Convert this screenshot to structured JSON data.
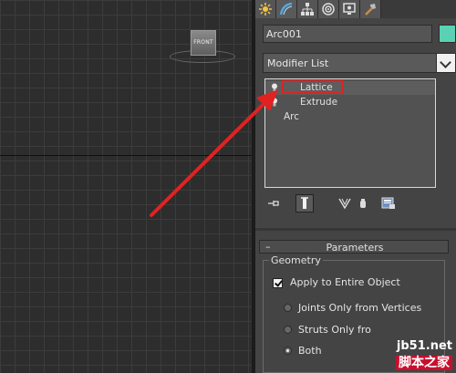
{
  "viewport": {
    "viewcube_label": "FRONT"
  },
  "command_panel": {
    "tabs": [
      {
        "icon": "create-icon"
      },
      {
        "icon": "modify-icon"
      },
      {
        "icon": "hierarchy-icon"
      },
      {
        "icon": "motion-icon"
      },
      {
        "icon": "display-icon"
      },
      {
        "icon": "utilities-icon"
      }
    ],
    "object_name": "Arc001",
    "object_color": "#5ad1b4",
    "modifier_list_label": "Modifier List",
    "stack": [
      {
        "label": "Lattice",
        "has_bulb": true
      },
      {
        "label": "Extrude",
        "has_bulb": true
      },
      {
        "label": "Arc",
        "has_bulb": false
      }
    ],
    "highlight_color": "#e02222"
  },
  "parameters": {
    "collapse_symbol": "–",
    "title": "Parameters",
    "group_title": "Geometry",
    "apply_entire_label": "Apply to Entire Object",
    "apply_entire_checked": true,
    "options": [
      {
        "label": "Joints Only from Vertices",
        "selected": false
      },
      {
        "label": "Struts Only fro",
        "selected": false
      },
      {
        "label": "Both",
        "selected": true
      }
    ]
  },
  "watermark": {
    "site": "jb51.net",
    "text": "脚本之家"
  }
}
